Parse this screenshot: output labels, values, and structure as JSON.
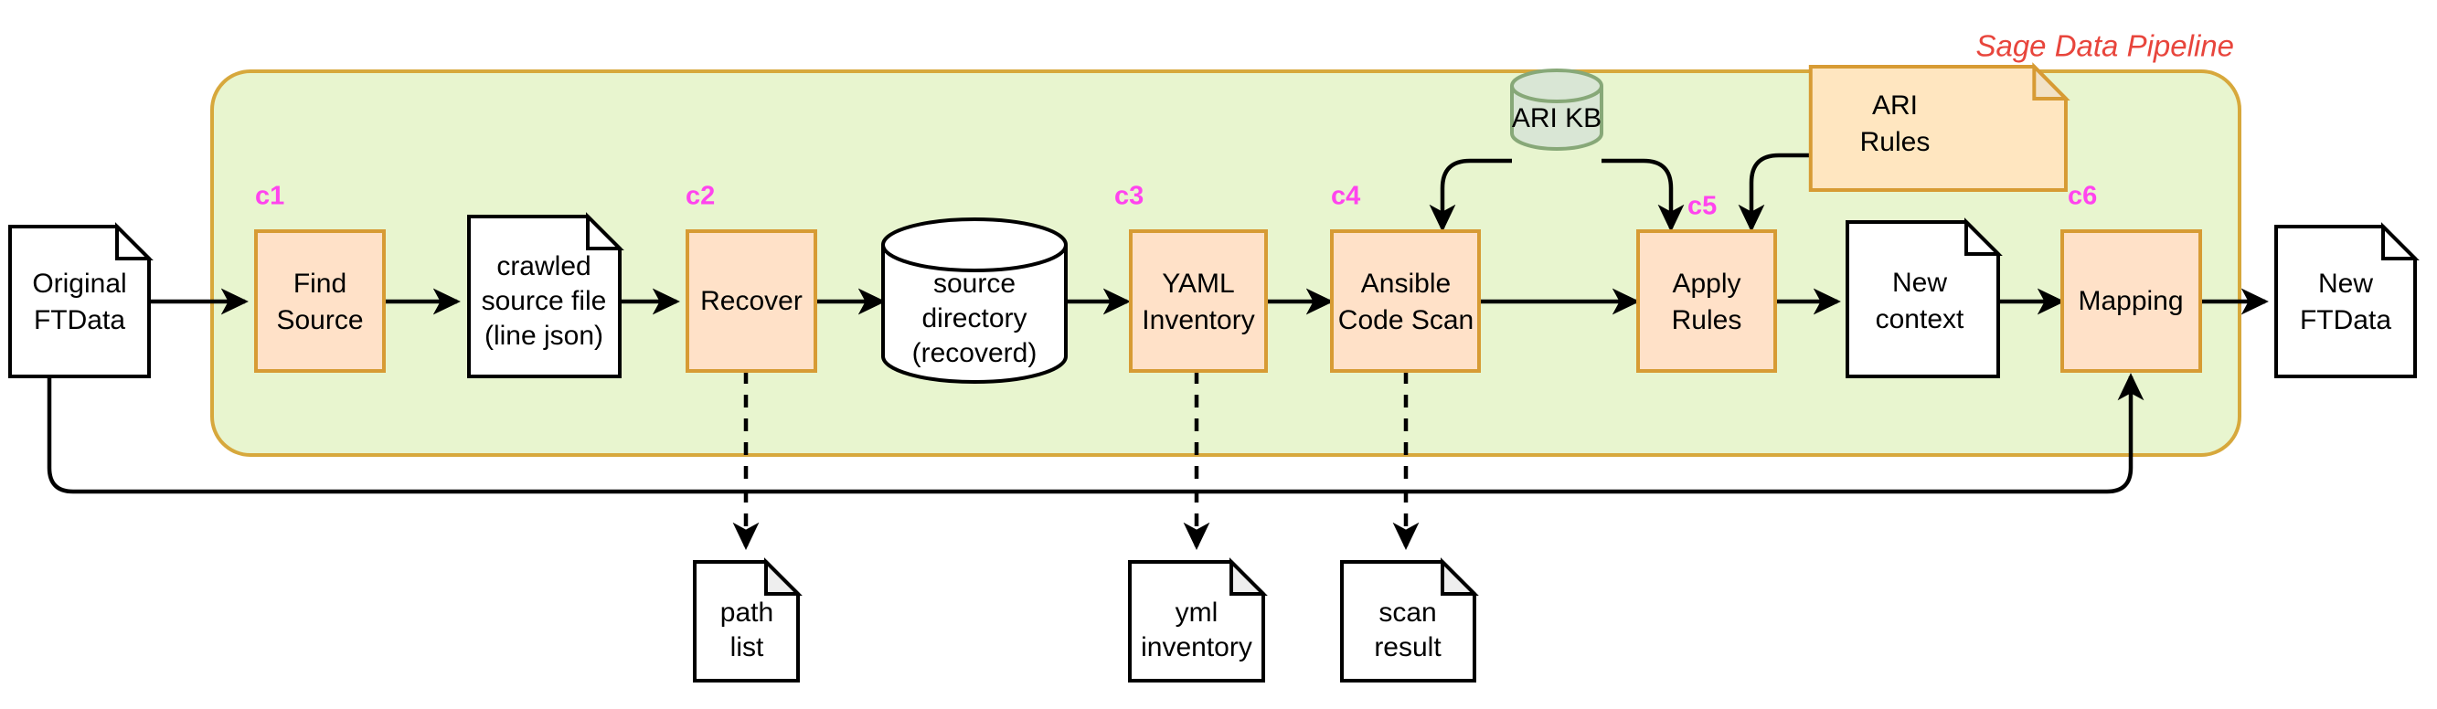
{
  "diagram": {
    "title": "Sage Data Pipeline",
    "title_color": "#e8453c",
    "group_fill": "#e8f5cf",
    "group_stroke": "#d7a83c",
    "process_fill": "#ffe1c8",
    "process_stroke": "#d79b34",
    "tag_color": "#ff44ee",
    "nodes": {
      "original_ftdata": {
        "label": "Original\nFTData",
        "line1": "Original",
        "line2": "FTData",
        "shape": "document"
      },
      "find_source": {
        "label": "Find Source",
        "line1": "Find",
        "line2": "Source",
        "shape": "process",
        "tag": "c1"
      },
      "crawled_source_file": {
        "line1": "crawled",
        "line2": "source file",
        "line3": "(line json)",
        "shape": "document"
      },
      "recover": {
        "line1": "Recover",
        "shape": "process",
        "tag": "c2"
      },
      "source_directory": {
        "line1": "source",
        "line2": "directory",
        "line3": "(recoverd)",
        "shape": "cylinder"
      },
      "yaml_inventory": {
        "line1": "YAML",
        "line2": "Inventory",
        "shape": "process",
        "tag": "c3"
      },
      "ansible_code_scan": {
        "line1": "Ansible",
        "line2": "Code Scan",
        "shape": "process",
        "tag": "c4"
      },
      "apply_rules": {
        "line1": "Apply",
        "line2": "Rules",
        "shape": "process",
        "tag": "c5"
      },
      "new_context": {
        "line1": "New",
        "line2": "context",
        "shape": "document"
      },
      "mapping": {
        "line1": "Mapping",
        "shape": "process",
        "tag": "c6"
      },
      "new_ftdata": {
        "line1": "New",
        "line2": "FTData",
        "shape": "document"
      },
      "ari_kb": {
        "line1": "ARI KB",
        "shape": "cylinder",
        "fill": "#d9e6d5",
        "stroke": "#87a878"
      },
      "ari_rules": {
        "line1": "ARI",
        "line2": "Rules",
        "shape": "note",
        "fill": "#ffe6c0",
        "stroke": "#d79b34"
      },
      "path_list": {
        "line1": "path",
        "line2": "list",
        "shape": "note"
      },
      "yml_inventory": {
        "line1": "yml",
        "line2": "inventory",
        "shape": "note"
      },
      "scan_result": {
        "line1": "scan",
        "line2": "result",
        "shape": "note"
      }
    },
    "tags": {
      "c1": "c1",
      "c2": "c2",
      "c3": "c3",
      "c4": "c4",
      "c5": "c5",
      "c6": "c6"
    }
  }
}
